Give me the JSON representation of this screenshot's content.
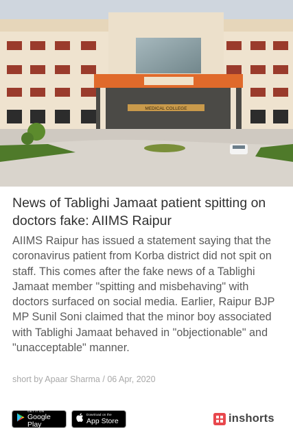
{
  "article": {
    "headline": "News of Tablighi Jamaat patient spitting on doctors fake: AIIMS Raipur",
    "body": "AIIMS Raipur has issued a statement saying that the coronavirus patient from Korba district did not spit on staff. This comes after the fake news of a Tablighi Jamaat member \"spitting and misbehaving\" with doctors surfaced on social media. Earlier, Raipur BJP MP Sunil Soni claimed that the minor boy associated with Tablighi Jamaat behaved in \"objectionable\" and \"unacceptable\" manner.",
    "byline_prefix": "short by",
    "author": "Apaar Sharma",
    "separator": "/",
    "date": "06 Apr, 2020",
    "hero_sign_text": "MEDICAL COLLEGE"
  },
  "footer": {
    "google_play": {
      "small": "GET IT ON",
      "big": "Google Play"
    },
    "app_store": {
      "small": "Download on the",
      "big": "App Store"
    },
    "brand_name": "inshorts"
  },
  "colors": {
    "brand_red": "#e8484d",
    "headline": "#303030",
    "body": "#5a5a5a",
    "byline": "#a8a8a8"
  },
  "icons": [
    "play-store-icon",
    "apple-icon",
    "inshorts-logo-icon"
  ]
}
